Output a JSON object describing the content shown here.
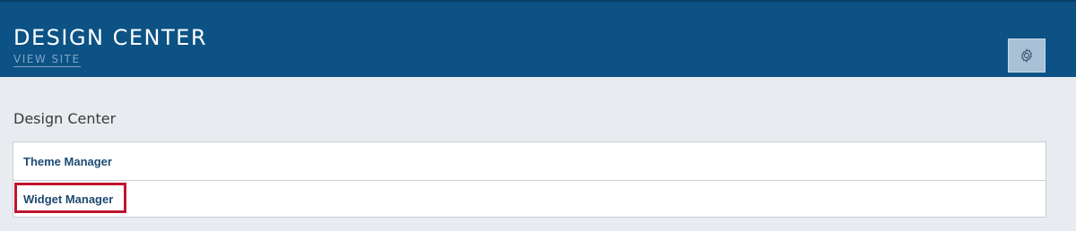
{
  "header": {
    "title": "DESIGN CENTER",
    "view_site_label": "VIEW SITE",
    "settings_icon": "gear-icon"
  },
  "main": {
    "section_title": "Design Center",
    "items": [
      {
        "label": "Theme Manager"
      },
      {
        "label": "Widget Manager",
        "highlighted": true
      }
    ]
  },
  "colors": {
    "header_bg": "#0c5285",
    "page_bg": "#e8ecf0",
    "link": "#1d4a73",
    "highlight": "#c0142e"
  }
}
